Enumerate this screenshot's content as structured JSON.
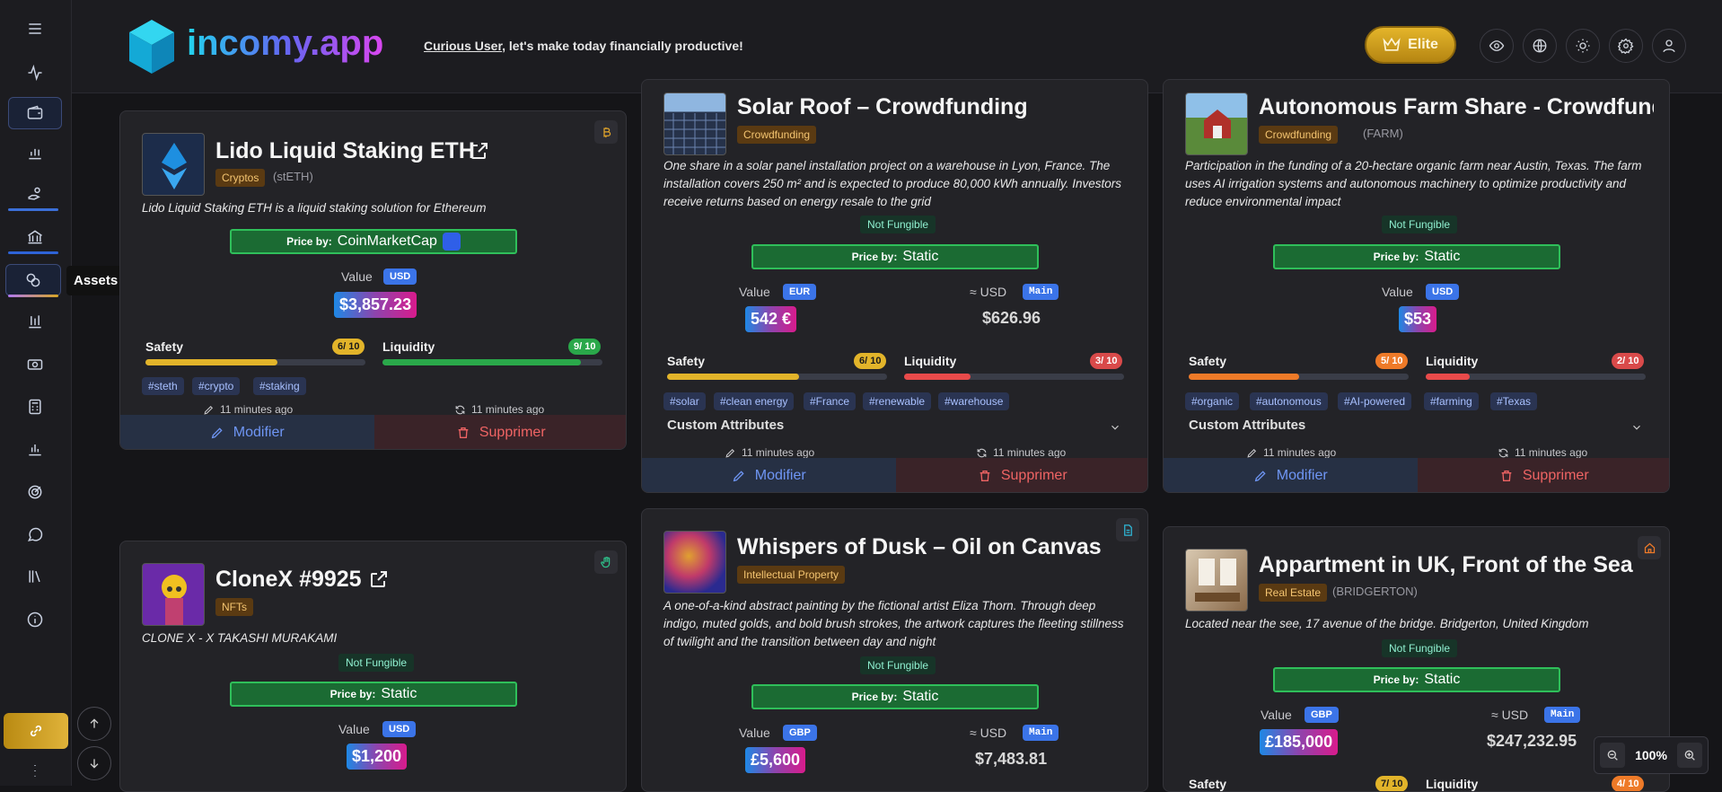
{
  "header": {
    "logo_text": "incomy.app",
    "user_name": "Curious User",
    "greeting": ", let's make today financially productive!",
    "elite_label": "Elite"
  },
  "sidebar": {
    "tooltip": "Assets",
    "colors": {
      "active_bar_1": "#3b6fd8",
      "active_bar_2": "#2e63d6",
      "active_bar_3": "#b07af0",
      "link": "#d6a525"
    }
  },
  "common": {
    "price_by": "Price by:",
    "value": "Value",
    "approx_usd": "≈ USD",
    "main": "Main",
    "safety": "Safety",
    "liquidity": "Liquidity",
    "not_fungible": "Not Fungible",
    "custom_attributes": "Custom Attributes",
    "modify": "Modifier",
    "delete": "Supprimer"
  },
  "cards": {
    "lido": {
      "title": "Lido Liquid Staking ETH",
      "category": "Cryptos",
      "symbol": "(stETH)",
      "description": "Lido Liquid Staking ETH is a liquid staking solution for Ethereum",
      "price_source": "CoinMarketCap",
      "currency": "USD",
      "value": "$3,857.23",
      "safety_score": "6/ 10",
      "safety": 6,
      "liquidity_score": "9/ 10",
      "liquidity": 9,
      "tags": [
        "#steth",
        "#crypto",
        "#staking"
      ],
      "created": "11 minutes ago",
      "updated": "11 minutes ago"
    },
    "solar": {
      "title": "Solar Roof – Crowdfunding",
      "category": "Crowdfunding",
      "description": "One share in a solar panel installation project on a warehouse in Lyon, France. The installation covers 250 m² and is expected to produce 80,000 kWh annually. Investors receive returns based on energy resale to the grid",
      "price_source": "Static",
      "currency": "EUR",
      "value": "542 €",
      "usd_value": "$626.96",
      "safety_score": "6/ 10",
      "safety": 6,
      "liquidity_score": "3/ 10",
      "liquidity": 3,
      "tags": [
        "#solar",
        "#clean energy",
        "#France",
        "#renewable",
        "#warehouse"
      ],
      "created": "11 minutes ago",
      "updated": "11 minutes ago"
    },
    "farm": {
      "title": "Autonomous Farm Share - Crowdfunding",
      "category": "Crowdfunding",
      "symbol": "(FARM)",
      "description": "Participation in the funding of a 20-hectare organic farm near Austin, Texas. The farm uses AI irrigation systems and autonomous machinery to optimize productivity and reduce environmental impact",
      "price_source": "Static",
      "currency": "USD",
      "value": "$53",
      "safety_score": "5/ 10",
      "safety": 5,
      "liquidity_score": "2/ 10",
      "liquidity": 2,
      "tags": [
        "#organic",
        "#autonomous",
        "#AI-powered",
        "#farming",
        "#Texas"
      ],
      "created": "11 minutes ago",
      "updated": "11 minutes ago"
    },
    "clonex": {
      "title": "CloneX #9925",
      "category": "NFTs",
      "description": "CLONE X - X TAKASHI MURAKAMI",
      "price_source": "Static",
      "currency": "USD",
      "value": "$1,200"
    },
    "painting": {
      "title": "Whispers of Dusk – Oil on Canvas",
      "category": "Intellectual Property",
      "description": "A one-of-a-kind abstract painting by the fictional artist Eliza Thorn. Through deep indigo, muted golds, and bold brush strokes, the artwork captures the fleeting stillness of twilight and the transition between day and night",
      "price_source": "Static",
      "currency": "GBP",
      "value": "£5,600",
      "usd_value": "$7,483.81"
    },
    "apartment": {
      "title": "Appartment in UK, Front of the Sea",
      "category": "Real Estate",
      "symbol": "(BRIDGERTON)",
      "description": "Located near the see, 17 avenue of the bridge. Bridgerton, United Kingdom",
      "price_source": "Static",
      "currency": "GBP",
      "value": "£185,000",
      "usd_value": "$247,232.95",
      "safety_score": "7/ 10",
      "safety": 7,
      "liquidity_score": "4/ 10",
      "liquidity": 4
    }
  },
  "zoom": {
    "level": "100%"
  }
}
